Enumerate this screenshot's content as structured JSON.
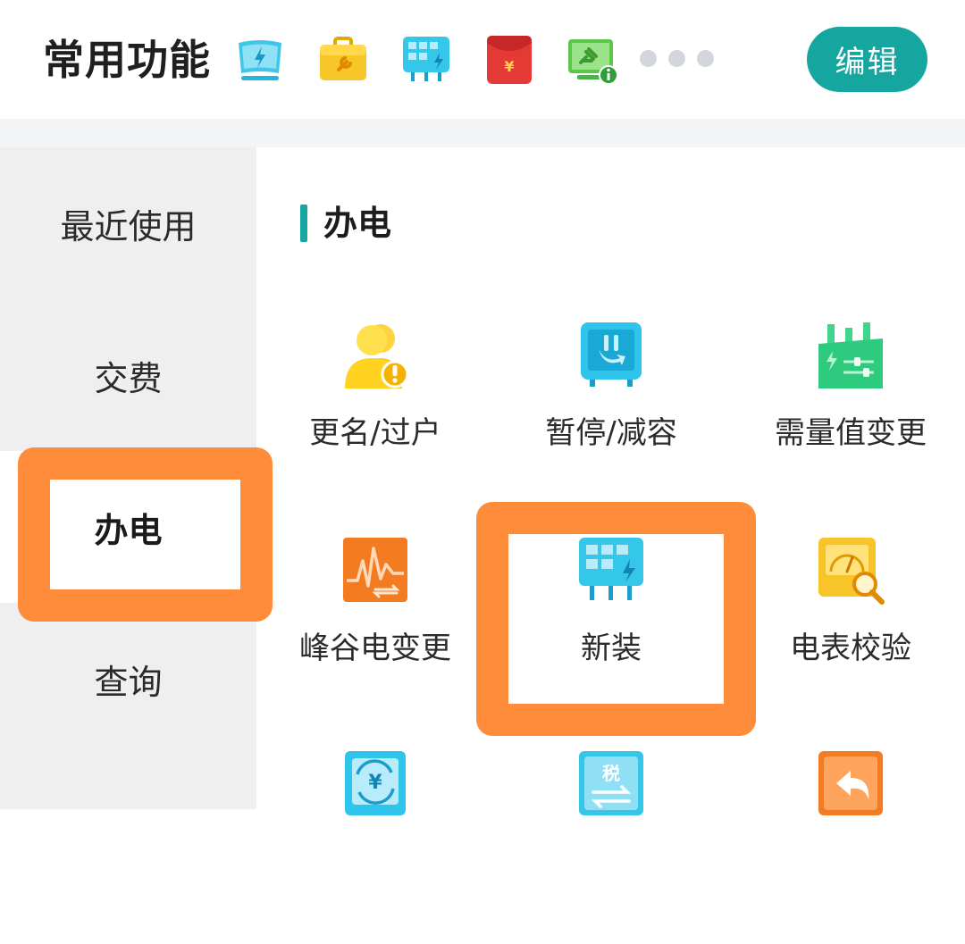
{
  "header": {
    "title": "常用功能",
    "favorites": [
      {
        "icon": "screen-bolt-icon",
        "color": "#1fb6e0"
      },
      {
        "icon": "wrench-toolbox-icon",
        "color": "#f4c20d"
      },
      {
        "icon": "meter-install-icon",
        "color": "#2ec4e6"
      },
      {
        "icon": "red-envelope-yuan-icon",
        "color": "#e53935"
      },
      {
        "icon": "plug-monitor-info-icon",
        "color": "#58c342"
      }
    ],
    "edit_label": "编辑"
  },
  "sidebar": {
    "items": [
      {
        "label": "最近使用",
        "active": false
      },
      {
        "label": "交费",
        "active": false
      },
      {
        "label": "办电",
        "active": true
      },
      {
        "label": "查询",
        "active": false
      }
    ]
  },
  "main": {
    "section_title": "办电",
    "items": [
      {
        "label": "更名/过户",
        "icon": "user-alert-icon"
      },
      {
        "label": "暂停/减容",
        "icon": "meter-pause-icon"
      },
      {
        "label": "需量值变更",
        "icon": "factory-adjust-icon"
      },
      {
        "label": "峰谷电变更",
        "icon": "peak-valley-icon"
      },
      {
        "label": "新装",
        "icon": "meter-install-icon"
      },
      {
        "label": "电表校验",
        "icon": "meter-inspect-icon"
      },
      {
        "label": "",
        "icon": "yuan-refresh-icon"
      },
      {
        "label": "",
        "icon": "tax-exchange-icon"
      },
      {
        "label": "",
        "icon": "return-arrow-icon"
      }
    ]
  },
  "colors": {
    "accent": "#16a6a0",
    "highlight": "#ff8c3b",
    "sidebar_bg": "#efefef"
  }
}
